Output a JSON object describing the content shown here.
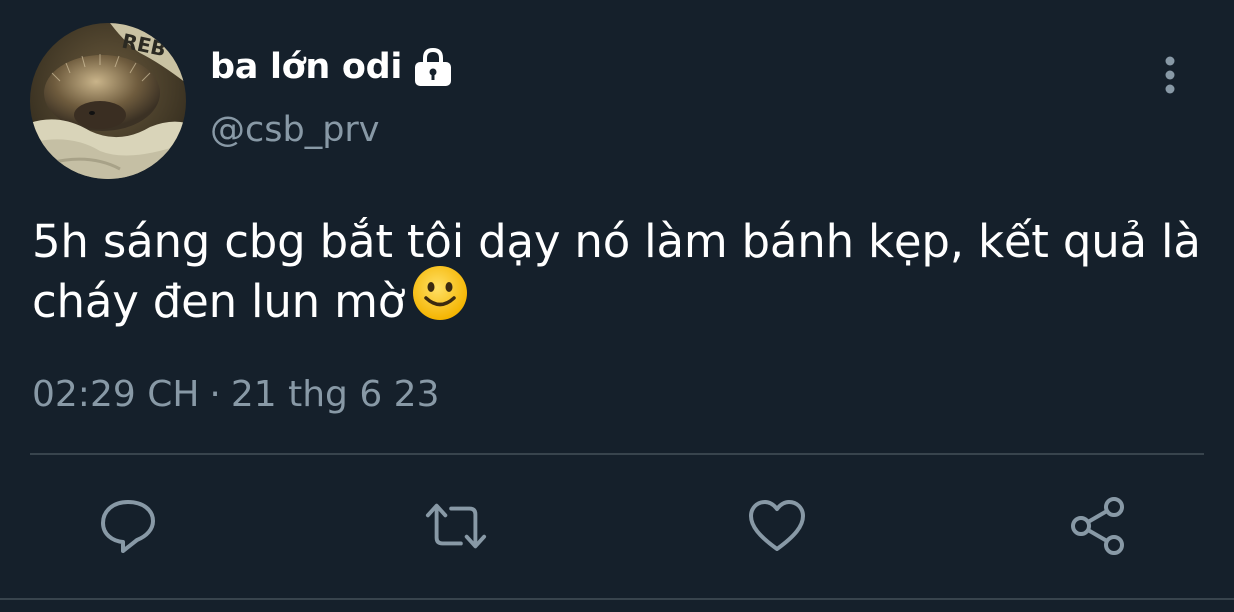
{
  "user": {
    "display_name": "ba lớn odi",
    "handle": "@csb_prv",
    "verified_lock": "lock-icon",
    "avatar": "hedgehog-photo"
  },
  "tweet": {
    "text": "5h sáng cbg bắt tôi dạy nó làm bánh kẹp, kết quả là cháy đen lun mờ",
    "emoji": "slightly-smiling-face",
    "time": "02:29 CH",
    "separator": "·",
    "date": "21 thg 6 23"
  },
  "actions": [
    {
      "name": "reply",
      "icon": "reply-icon"
    },
    {
      "name": "retweet",
      "icon": "retweet-icon"
    },
    {
      "name": "like",
      "icon": "heart-icon"
    },
    {
      "name": "share",
      "icon": "share-icon"
    }
  ],
  "colors": {
    "background": "#15202b",
    "secondary_text": "#8899a6",
    "divider": "#38444d",
    "primary_text": "#ffffff"
  }
}
